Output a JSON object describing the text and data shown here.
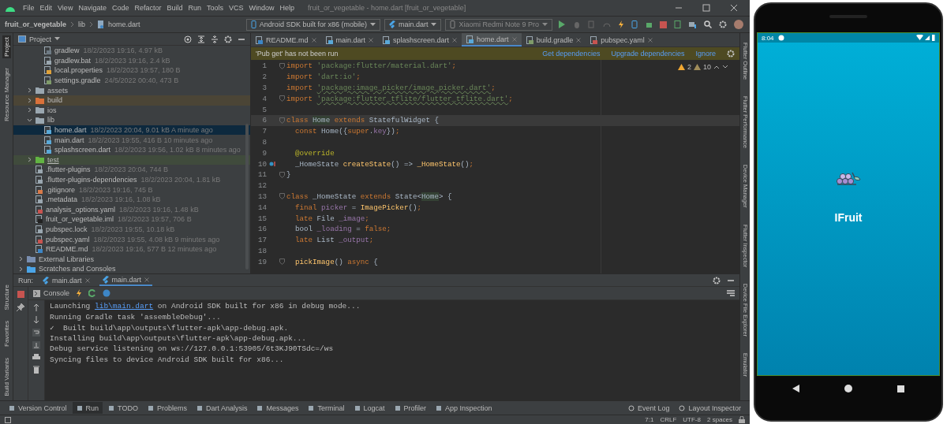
{
  "window": {
    "title": "fruit_or_vegetable - home.dart [fruit_or_vegetable]"
  },
  "menu": [
    "File",
    "Edit",
    "View",
    "Navigate",
    "Code",
    "Refactor",
    "Build",
    "Run",
    "Tools",
    "VCS",
    "Window",
    "Help"
  ],
  "breadcrumb": [
    "fruit_or_vegetable",
    "lib",
    "home.dart"
  ],
  "toolbar": {
    "device": "Android SDK built for x86 (mobile)",
    "run_config": "main.dart",
    "target": {
      "label": "Xiaomi Redmi Note 9 Pro",
      "disabled": true
    }
  },
  "left_strip_top": [
    "Project",
    "Resource Manager"
  ],
  "left_strip_bottom": [
    "Structure",
    "Favorites",
    "Build Variants"
  ],
  "right_strip": [
    "Flutter Outline",
    "Flutter Performance",
    "Device Manager",
    "Flutter Inspector",
    "Device File Explorer",
    "Emulator"
  ],
  "project": {
    "title": "Project",
    "tree": [
      {
        "children": [
          {
            "children": [
              {
                "label": "gradlew",
                "meta": "18/2/2023 19:16, 4.97 kB",
                "kind": "script",
                "selected": false
              },
              {
                "label": "gradlew.bat",
                "meta": "18/2/2023 19:16, 2.4 kB",
                "kind": "text",
                "selected": false
              },
              {
                "label": "local.properties",
                "meta": "18/2/2023 19:57, 180 B",
                "kind": "properties",
                "selected": false
              },
              {
                "label": "settings.gradle",
                "meta": "24/5/2022 00:40, 473 B",
                "kind": "gradle",
                "selected": false
              }
            ]
          },
          {
            "label": "assets",
            "kind": "folder",
            "expanded": false,
            "selected": false
          },
          {
            "label": "build",
            "kind": "excluded_folder",
            "expanded": false,
            "selected": false
          },
          {
            "label": "ios",
            "kind": "folder",
            "expanded": false,
            "selected": false
          },
          {
            "label": "lib",
            "kind": "folder",
            "expanded": true,
            "selected": false,
            "children": [
              {
                "label": "home.dart",
                "meta": "18/2/2023 20:04, 9.01 kB A minute ago",
                "kind": "dart",
                "selected": true
              },
              {
                "label": "main.dart",
                "meta": "18/2/2023 19:55, 416 B 10 minutes ago",
                "kind": "dart",
                "selected": false
              },
              {
                "label": "splashscreen.dart",
                "meta": "18/2/2023 19:56, 1.02 kB 8 minutes ago",
                "kind": "dart",
                "selected": false
              }
            ]
          },
          {
            "label": "test",
            "kind": "test_folder",
            "expanded": false,
            "selected": false
          },
          {
            "label": ".flutter-plugins",
            "meta": "18/2/2023 20:04, 744 B",
            "kind": "text",
            "selected": false
          },
          {
            "label": ".flutter-plugins-dependencies",
            "meta": "18/2/2023 20:04, 1.81 kB",
            "kind": "text",
            "selected": false
          },
          {
            "label": ".gitignore",
            "meta": "18/2/2023 19:16, 745 B",
            "kind": "git",
            "selected": false
          },
          {
            "label": ".metadata",
            "meta": "18/2/2023 19:16, 1.08 kB",
            "kind": "text",
            "selected": false
          },
          {
            "label": "analysis_options.yaml",
            "meta": "18/2/2023 19:16, 1.48 kB",
            "kind": "yaml",
            "selected": false
          },
          {
            "label": "fruit_or_vegetable.iml",
            "meta": "18/2/2023 19:57, 706 B",
            "kind": "iml",
            "selected": false
          },
          {
            "label": "pubspec.lock",
            "meta": "18/2/2023 19:55, 10.18 kB",
            "kind": "text",
            "selected": false
          },
          {
            "label": "pubspec.yaml",
            "meta": "18/2/2023 19:55, 4.08 kB 9 minutes ago",
            "kind": "yaml",
            "selected": false
          },
          {
            "label": "README.md",
            "meta": "18/2/2023 19:16, 577 B 12 minutes ago",
            "kind": "md",
            "selected": false
          }
        ]
      },
      {
        "label": "External Libraries",
        "kind": "library",
        "expanded": false,
        "selected": false
      },
      {
        "label": "Scratches and Consoles",
        "kind": "scratches",
        "expanded": false,
        "selected": false
      }
    ]
  },
  "editor": {
    "tabs": [
      {
        "label": "README.md",
        "kind": "md",
        "selected": false
      },
      {
        "label": "main.dart",
        "kind": "dart",
        "selected": false
      },
      {
        "label": "splashscreen.dart",
        "kind": "dart",
        "selected": false
      },
      {
        "label": "home.dart",
        "kind": "dart",
        "selected": true
      },
      {
        "label": "build.gradle",
        "kind": "gradle",
        "selected": false
      },
      {
        "label": "pubspec.yaml",
        "kind": "yaml",
        "selected": false
      }
    ],
    "notice": {
      "text": "'Pub get' has not been run",
      "actions": [
        "Get dependencies",
        "Upgrade dependencies",
        "Ignore"
      ]
    },
    "warnings": "2",
    "weak_warnings": "10",
    "lines": [
      {
        "number": "1",
        "fold": true,
        "tokens": [
          {
            "kind": "kw",
            "text": "import "
          },
          {
            "kind": "str",
            "text": "'package:flutter/material.dart'"
          },
          {
            "kind": "kw",
            "text": ";"
          }
        ]
      },
      {
        "number": "2",
        "tokens": [
          {
            "kind": "kw",
            "text": "import "
          },
          {
            "kind": "str",
            "text": "'dart:io'"
          },
          {
            "kind": "kw",
            "text": ";"
          }
        ]
      },
      {
        "number": "3",
        "tokens": [
          {
            "kind": "kw",
            "text": "import "
          },
          {
            "kind": "strw",
            "text": "'package:image_picker/image_picker.dart'"
          },
          {
            "kind": "kw",
            "text": ";"
          }
        ]
      },
      {
        "number": "4",
        "fold": true,
        "tokens": [
          {
            "kind": "kw",
            "text": "import "
          },
          {
            "kind": "strw",
            "text": "'package:flutter_tflite/flutter_tflite.dart'"
          },
          {
            "kind": "kw",
            "text": ";"
          }
        ]
      },
      {
        "number": "5"
      },
      {
        "number": "6",
        "fold": true,
        "current": true,
        "tokens": [
          {
            "kind": "kw",
            "text": "class "
          },
          {
            "kind": "hl",
            "text": "Home"
          },
          {
            "kind": "kw",
            "text": " extends "
          },
          {
            "kind": "p",
            "text": "StatefulWidget {"
          }
        ]
      },
      {
        "number": "7",
        "tokens": [
          {
            "kind": "kw",
            "text": "  const "
          },
          {
            "kind": "p",
            "text": "Home({"
          },
          {
            "kind": "kw",
            "text": "super"
          },
          {
            "kind": "p",
            "text": "."
          },
          {
            "kind": "fld",
            "text": "key"
          },
          {
            "kind": "p",
            "text": "})"
          },
          {
            "kind": "kw",
            "text": ";"
          }
        ]
      },
      {
        "number": "8"
      },
      {
        "number": "9",
        "tokens": [
          {
            "kind": "ann",
            "text": "  @override"
          }
        ]
      },
      {
        "number": "10",
        "marker": true,
        "tokens": [
          {
            "kind": "p",
            "text": "  _HomeState "
          },
          {
            "kind": "fn",
            "text": "createState"
          },
          {
            "kind": "p",
            "text": "() => "
          },
          {
            "kind": "fn",
            "text": "_HomeState"
          },
          {
            "kind": "p",
            "text": "()"
          },
          {
            "kind": "kw",
            "text": ";"
          }
        ]
      },
      {
        "number": "11",
        "fold": true,
        "tokens": [
          {
            "kind": "p",
            "text": "}"
          }
        ]
      },
      {
        "number": "12"
      },
      {
        "number": "13",
        "fold": true,
        "tokens": [
          {
            "kind": "kw",
            "text": "class "
          },
          {
            "kind": "p",
            "text": "_HomeState "
          },
          {
            "kind": "kw",
            "text": "extends "
          },
          {
            "kind": "p",
            "text": "State<"
          },
          {
            "kind": "hl",
            "text": "Home"
          },
          {
            "kind": "p",
            "text": "> {"
          }
        ]
      },
      {
        "number": "14",
        "tokens": [
          {
            "kind": "kw",
            "text": "  final "
          },
          {
            "kind": "fld",
            "text": "picker"
          },
          {
            "kind": "p",
            "text": " = "
          },
          {
            "kind": "fn",
            "text": "ImagePicker"
          },
          {
            "kind": "p",
            "text": "()"
          },
          {
            "kind": "kw",
            "text": ";"
          }
        ]
      },
      {
        "number": "15",
        "tokens": [
          {
            "kind": "kw",
            "text": "  late "
          },
          {
            "kind": "p",
            "text": "File "
          },
          {
            "kind": "fld",
            "text": "_image"
          },
          {
            "kind": "kw",
            "text": ";"
          }
        ]
      },
      {
        "number": "16",
        "tokens": [
          {
            "kind": "p",
            "text": "  bool "
          },
          {
            "kind": "fld",
            "text": "_loading"
          },
          {
            "kind": "p",
            "text": " = "
          },
          {
            "kind": "kw",
            "text": "false;"
          }
        ]
      },
      {
        "number": "17",
        "tokens": [
          {
            "kind": "kw",
            "text": "  late "
          },
          {
            "kind": "p",
            "text": "List "
          },
          {
            "kind": "fld",
            "text": "_output"
          },
          {
            "kind": "kw",
            "text": ";"
          }
        ]
      },
      {
        "number": "18"
      },
      {
        "number": "19",
        "fold": true,
        "tokens": [
          {
            "kind": "fn",
            "text": "  pickImage"
          },
          {
            "kind": "p",
            "text": "() "
          },
          {
            "kind": "kw",
            "text": "async "
          },
          {
            "kind": "p",
            "text": "{"
          }
        ]
      }
    ]
  },
  "run": {
    "label": "Run:",
    "tabs": [
      {
        "label": "main.dart",
        "selected": false
      },
      {
        "label": "main.dart",
        "selected": true
      }
    ],
    "console_label": "Console",
    "lines": [
      {
        "before": "Launching ",
        "link": "lib\\main.dart",
        "after": " on Android SDK built for x86 in debug mode..."
      },
      {
        "text": "Running Gradle task 'assembleDebug'..."
      },
      {
        "text": "✓  Built build\\app\\outputs\\flutter-apk\\app-debug.apk."
      },
      {
        "text": "Installing build\\app\\outputs\\flutter-apk\\app-debug.apk..."
      },
      {
        "text": "Debug service listening on ws://127.0.0.1:53905/6t3KJ90TSdc=/ws"
      },
      {
        "text": "Syncing files to device Android SDK built for x86..."
      }
    ]
  },
  "tool_tabs": [
    {
      "label": "Version Control",
      "selected": false
    },
    {
      "label": "Run",
      "selected": true
    },
    {
      "label": "TODO",
      "selected": false
    },
    {
      "label": "Problems",
      "selected": false
    },
    {
      "label": "Dart Analysis",
      "selected": false
    },
    {
      "label": "Messages",
      "selected": false
    },
    {
      "label": "Terminal",
      "selected": false
    },
    {
      "label": "Logcat",
      "selected": false
    },
    {
      "label": "Profiler",
      "selected": false
    },
    {
      "label": "App Inspection",
      "selected": false
    }
  ],
  "tool_tabs_right": [
    "Event Log",
    "Layout Inspector"
  ],
  "status": [
    "7:1",
    "CRLF",
    "UTF-8",
    "2 spaces"
  ],
  "phone": {
    "time": "8:04",
    "app_title": "IFruit"
  }
}
